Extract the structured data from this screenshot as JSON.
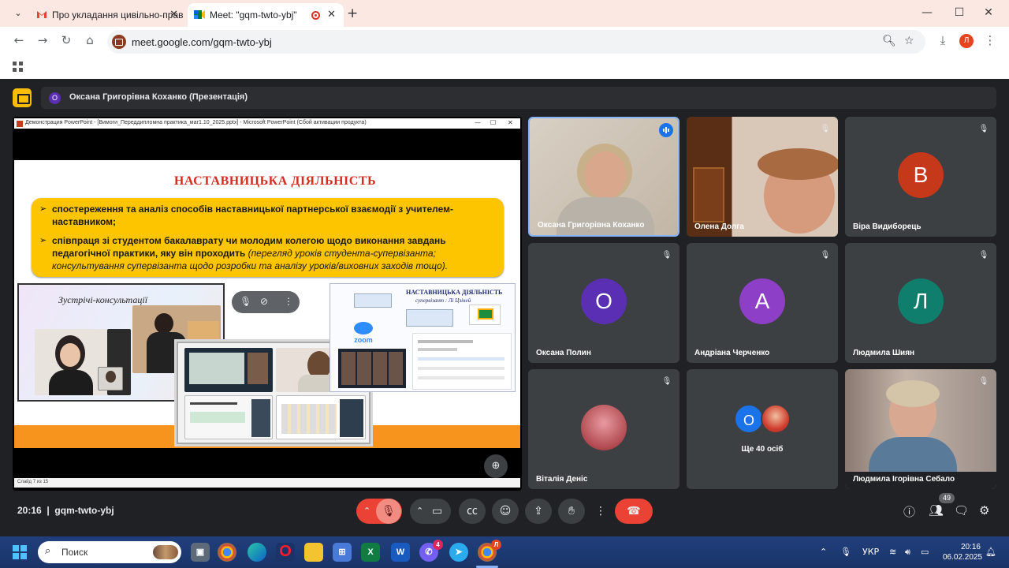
{
  "browser": {
    "tabs": [
      {
        "title": "Про укладання цивільно-прав"
      },
      {
        "title": "Meet: \"gqm-twto-ybj\""
      }
    ],
    "url": "meet.google.com/gqm-twto-ybj",
    "profile_initial": "Л"
  },
  "meet": {
    "presenter_initial": "О",
    "presenter_label": "Оксана Григорівна Коханко (Презентація)",
    "ppt": {
      "window_title": "Демонстрация PowerPoint - [Вимоги_Переддипломна практика_маг1.10_2025.pptx] - Microsoft PowerPoint (Сбой активации продукта)",
      "status": "Слайд 7 из 15"
    },
    "slide": {
      "title": "НАСТАВНИЦЬКА ДІЯЛЬНІСТЬ",
      "bullet1": "спостереження та аналіз способів наставницької партнерської взаємодії з учителем-наставником;",
      "bullet2_main": "співпраця зі студентом бакалаврату чи молодим колегою щодо виконання завдань педагогічної практики, яку він проходить ",
      "bullet2_italic": "(перегляд уроків студента-супервізанта; консультування супервізанта щодо розробки та аналізу уроків/виховних заходів тощо).",
      "collage1_title": "Зустрічі-консультації",
      "collage3_title": "НАСТАВНИЦЬКА ДІЯЛЬНІСТЬ",
      "collage3_sub": "супервізант : Лі Цзіней",
      "zoom_label": "zoom"
    },
    "participants": [
      {
        "name": "Оксана Григорівна Коханко",
        "type": "video",
        "speaking": true
      },
      {
        "name": "Олена Долга",
        "type": "video",
        "muted": true
      },
      {
        "name": "Віра Видиборець",
        "initial": "В",
        "color": "#c5381a",
        "muted": true
      },
      {
        "name": "Оксана Полин",
        "initial": "О",
        "color": "#5b2fb3",
        "muted": true
      },
      {
        "name": "Андріана Черченко",
        "initial": "А",
        "color": "#8e3fc7",
        "muted": true
      },
      {
        "name": "Людмила Шиян",
        "initial": "Л",
        "color": "#0f7e6d",
        "muted": true
      },
      {
        "name": "Віталія Деніс",
        "type": "photo",
        "muted": true
      },
      {
        "name": "Людмила Ігорівна Себало",
        "type": "video",
        "muted": true
      }
    ],
    "more": {
      "initial": "О",
      "label": "Ще 40 осіб"
    },
    "bottom": {
      "time": "20:16",
      "code": "gqm-twto-ybj",
      "people_count": "49"
    }
  },
  "taskbar": {
    "search_placeholder": "Поиск",
    "viber_badge": "4",
    "chrome_badge": "Л",
    "language": "УКР",
    "time": "20:16",
    "date": "06.02.2025"
  }
}
